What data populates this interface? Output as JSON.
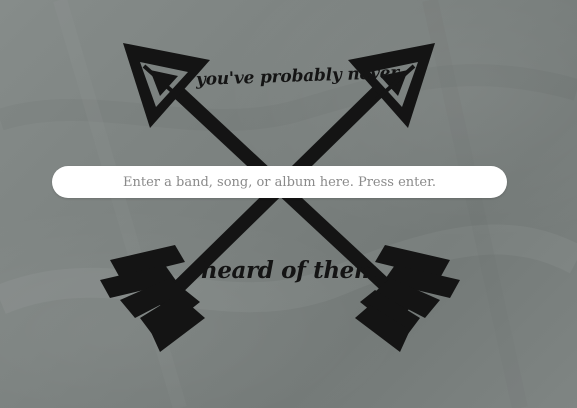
{
  "logo": {
    "tagline_top": "you've probably never",
    "tagline_bottom": "heard of them",
    "icon": "crossed-arrows-icon",
    "color": "#141414"
  },
  "search": {
    "placeholder": "Enter a band, song, or album here. Press enter.",
    "value": ""
  },
  "colors": {
    "background": "#7c8280",
    "search_background": "#ffffff"
  }
}
